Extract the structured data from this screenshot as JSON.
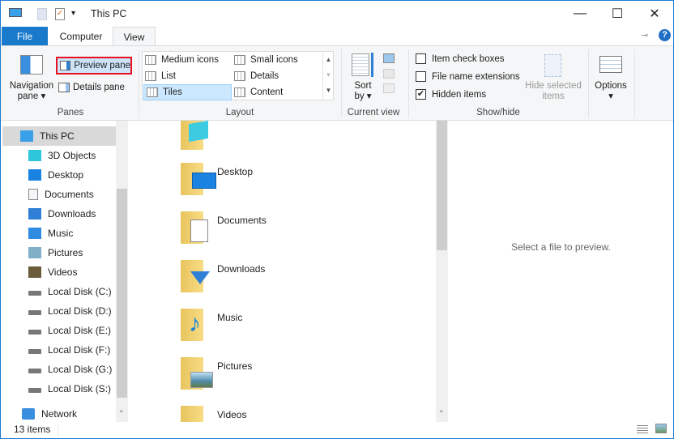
{
  "window": {
    "title": "This PC",
    "minimize": "—",
    "maximize": "☐",
    "close": "✕",
    "help": "?"
  },
  "tabs": [
    {
      "label": "File"
    },
    {
      "label": "Computer"
    },
    {
      "label": "View"
    }
  ],
  "ribbon": {
    "panes": {
      "label": "Panes",
      "navigation_pane": "Navigation",
      "navigation_pane2": "pane",
      "preview_pane": "Preview pane",
      "details_pane": "Details pane"
    },
    "layout": {
      "label": "Layout",
      "items": [
        "Medium icons",
        "Small icons",
        "List",
        "Details",
        "Tiles",
        "Content"
      ],
      "selected": "Tiles"
    },
    "current_view": {
      "label": "Current view",
      "sort_by": "Sort",
      "sort_by2": "by"
    },
    "show_hide": {
      "label": "Show/hide",
      "item_check_boxes": "Item check boxes",
      "file_name_extensions": "File name extensions",
      "hidden_items": "Hidden items",
      "hidden_checked": true,
      "hide_selected": "Hide selected",
      "hide_selected2": "items"
    },
    "options": {
      "label": "Options"
    }
  },
  "nav": {
    "items": [
      "This PC",
      "3D Objects",
      "Desktop",
      "Documents",
      "Downloads",
      "Music",
      "Pictures",
      "Videos",
      "Local Disk (C:)",
      "Local Disk (D:)",
      "Local Disk (E:)",
      "Local Disk (F:)",
      "Local Disk (G:)",
      "Local Disk (S:)"
    ],
    "network": "Network"
  },
  "files": [
    "Desktop",
    "Documents",
    "Downloads",
    "Music",
    "Pictures",
    "Videos"
  ],
  "preview": {
    "message": "Select a file to preview."
  },
  "status": {
    "count": "13 items"
  },
  "colors": {
    "accent": "#1979ca",
    "highlight": "#cce8ff",
    "red_box": "#e81123"
  }
}
